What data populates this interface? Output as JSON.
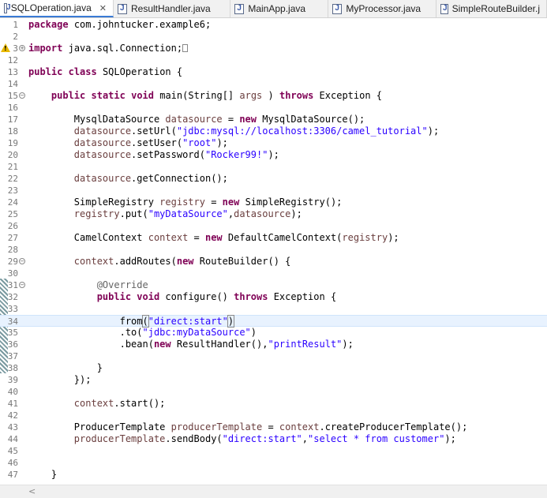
{
  "tabs": [
    {
      "label": "SQLOperation.java",
      "active": true,
      "closable": true
    },
    {
      "label": "ResultHandler.java"
    },
    {
      "label": "MainApp.java"
    },
    {
      "label": "MyProcessor.java"
    },
    {
      "label": "SimpleRouteBuilder.j"
    }
  ],
  "editor": {
    "current_line": 34,
    "lines": [
      {
        "n": "1",
        "segs": [
          [
            "kw",
            "package"
          ],
          [
            "",
            "com.johntucker.example6;"
          ]
        ]
      },
      {
        "n": "2",
        "segs": []
      },
      {
        "n": "3",
        "fold": "plus",
        "warn": true,
        "segs": [
          [
            "kw",
            "import"
          ],
          [
            "",
            "java.sql.Connection;"
          ]
        ],
        "ws": true
      },
      {
        "n": "12",
        "segs": []
      },
      {
        "n": "13",
        "segs": [
          [
            "kw",
            "public"
          ],
          [
            "kw",
            "class"
          ],
          [
            "",
            "SQLOperation {"
          ]
        ]
      },
      {
        "n": "14",
        "segs": []
      },
      {
        "n": "15",
        "fold": "minus",
        "segs": [
          [
            "",
            "    "
          ],
          [
            "kw",
            "public"
          ],
          [
            "kw",
            "static"
          ],
          [
            "kw",
            "void"
          ],
          [
            "",
            " main(String[] "
          ],
          [
            "fld",
            "args"
          ],
          [
            "",
            " ) "
          ],
          [
            "kw",
            "throws"
          ],
          [
            "",
            " Exception {"
          ]
        ]
      },
      {
        "n": "16",
        "segs": []
      },
      {
        "n": "17",
        "segs": [
          [
            "",
            "        MysqlDataSource "
          ],
          [
            "fld",
            "datasource"
          ],
          [
            "",
            " = "
          ],
          [
            "kw",
            "new"
          ],
          [
            "",
            " MysqlDataSource();"
          ]
        ]
      },
      {
        "n": "18",
        "segs": [
          [
            "",
            "        "
          ],
          [
            "fld",
            "datasource"
          ],
          [
            "",
            ".setUrl("
          ],
          [
            "str",
            "\"jdbc:mysql://localhost:3306/camel_tutorial\""
          ],
          [
            "",
            ");"
          ]
        ]
      },
      {
        "n": "19",
        "segs": [
          [
            "",
            "        "
          ],
          [
            "fld",
            "datasource"
          ],
          [
            "",
            ".setUser("
          ],
          [
            "str",
            "\"root\""
          ],
          [
            "",
            ");"
          ]
        ]
      },
      {
        "n": "20",
        "segs": [
          [
            "",
            "        "
          ],
          [
            "fld",
            "datasource"
          ],
          [
            "",
            ".setPassword("
          ],
          [
            "str",
            "\"Rocker99!\""
          ],
          [
            "",
            ");"
          ]
        ]
      },
      {
        "n": "21",
        "segs": []
      },
      {
        "n": "22",
        "segs": [
          [
            "",
            "        "
          ],
          [
            "fld",
            "datasource"
          ],
          [
            "",
            ".getConnection();"
          ]
        ]
      },
      {
        "n": "23",
        "segs": []
      },
      {
        "n": "24",
        "segs": [
          [
            "",
            "        SimpleRegistry "
          ],
          [
            "fld",
            "registry"
          ],
          [
            "",
            " = "
          ],
          [
            "kw",
            "new"
          ],
          [
            "",
            " SimpleRegistry();"
          ]
        ]
      },
      {
        "n": "25",
        "segs": [
          [
            "",
            "        "
          ],
          [
            "fld",
            "registry"
          ],
          [
            "",
            ".put("
          ],
          [
            "str",
            "\"myDataSource\""
          ],
          [
            "",
            ","
          ],
          [
            "fld",
            "datasource"
          ],
          [
            "",
            ");"
          ]
        ]
      },
      {
        "n": "26",
        "segs": []
      },
      {
        "n": "27",
        "segs": [
          [
            "",
            "        CamelContext "
          ],
          [
            "fld",
            "context"
          ],
          [
            "",
            " = "
          ],
          [
            "kw",
            "new"
          ],
          [
            "",
            " DefaultCamelContext("
          ],
          [
            "fld",
            "registry"
          ],
          [
            "",
            ");"
          ]
        ]
      },
      {
        "n": "28",
        "segs": []
      },
      {
        "n": "29",
        "fold": "minus",
        "segs": [
          [
            "",
            "        "
          ],
          [
            "fld",
            "context"
          ],
          [
            "",
            ".addRoutes("
          ],
          [
            "kw",
            "new"
          ],
          [
            "",
            " RouteBuilder() {"
          ]
        ]
      },
      {
        "n": "30",
        "segs": []
      },
      {
        "n": "31",
        "fold": "minus",
        "segs": [
          [
            "",
            "            "
          ],
          [
            "ann",
            "@Override"
          ]
        ]
      },
      {
        "n": "32",
        "segs": [
          [
            "",
            "            "
          ],
          [
            "kw",
            "public"
          ],
          [
            "kw",
            "void"
          ],
          [
            "",
            " configure() "
          ],
          [
            "kw",
            "throws"
          ],
          [
            "",
            " Exception {"
          ]
        ]
      },
      {
        "n": "33",
        "segs": []
      },
      {
        "n": "34",
        "segs": [
          [
            "",
            "                from"
          ],
          [
            "bkt",
            "("
          ],
          [
            "str",
            "\"direct:start\""
          ],
          [
            "bkt",
            ")"
          ],
          [
            "caret",
            ""
          ]
        ]
      },
      {
        "n": "35",
        "segs": [
          [
            "",
            "                .to("
          ],
          [
            "str",
            "\"jdbc:myDataSource\""
          ],
          [
            "",
            ")"
          ]
        ]
      },
      {
        "n": "36",
        "segs": [
          [
            "",
            "                .bean("
          ],
          [
            "kw",
            "new"
          ],
          [
            "",
            " ResultHandler(),"
          ],
          [
            "str",
            "\"printResult\""
          ],
          [
            "",
            ");"
          ]
        ]
      },
      {
        "n": "37",
        "segs": []
      },
      {
        "n": "38",
        "segs": [
          [
            "",
            "            }"
          ]
        ]
      },
      {
        "n": "39",
        "segs": [
          [
            "",
            "        });"
          ]
        ]
      },
      {
        "n": "40",
        "segs": []
      },
      {
        "n": "41",
        "segs": [
          [
            "",
            "        "
          ],
          [
            "fld",
            "context"
          ],
          [
            "",
            ".start();"
          ]
        ]
      },
      {
        "n": "42",
        "segs": []
      },
      {
        "n": "43",
        "segs": [
          [
            "",
            "        ProducerTemplate "
          ],
          [
            "fld",
            "producerTemplate"
          ],
          [
            "",
            " = "
          ],
          [
            "fld",
            "context"
          ],
          [
            "",
            ".createProducerTemplate();"
          ]
        ]
      },
      {
        "n": "44",
        "segs": [
          [
            "",
            "        "
          ],
          [
            "fld",
            "producerTemplate"
          ],
          [
            "",
            ".sendBody("
          ],
          [
            "str",
            "\"direct:start\""
          ],
          [
            "",
            ","
          ],
          [
            "str",
            "\"select * from customer\""
          ],
          [
            "",
            ");"
          ]
        ]
      },
      {
        "n": "45",
        "segs": []
      },
      {
        "n": "46",
        "segs": []
      },
      {
        "n": "47",
        "segs": [
          [
            "",
            "    }"
          ]
        ]
      }
    ]
  },
  "scrollbar": {
    "left_arrow": "<"
  },
  "colors": {
    "keyword": "#7f0055",
    "string": "#2a00ff",
    "field": "#6a3e3e",
    "annotation": "#646464",
    "current_line": "#e8f2fe"
  }
}
